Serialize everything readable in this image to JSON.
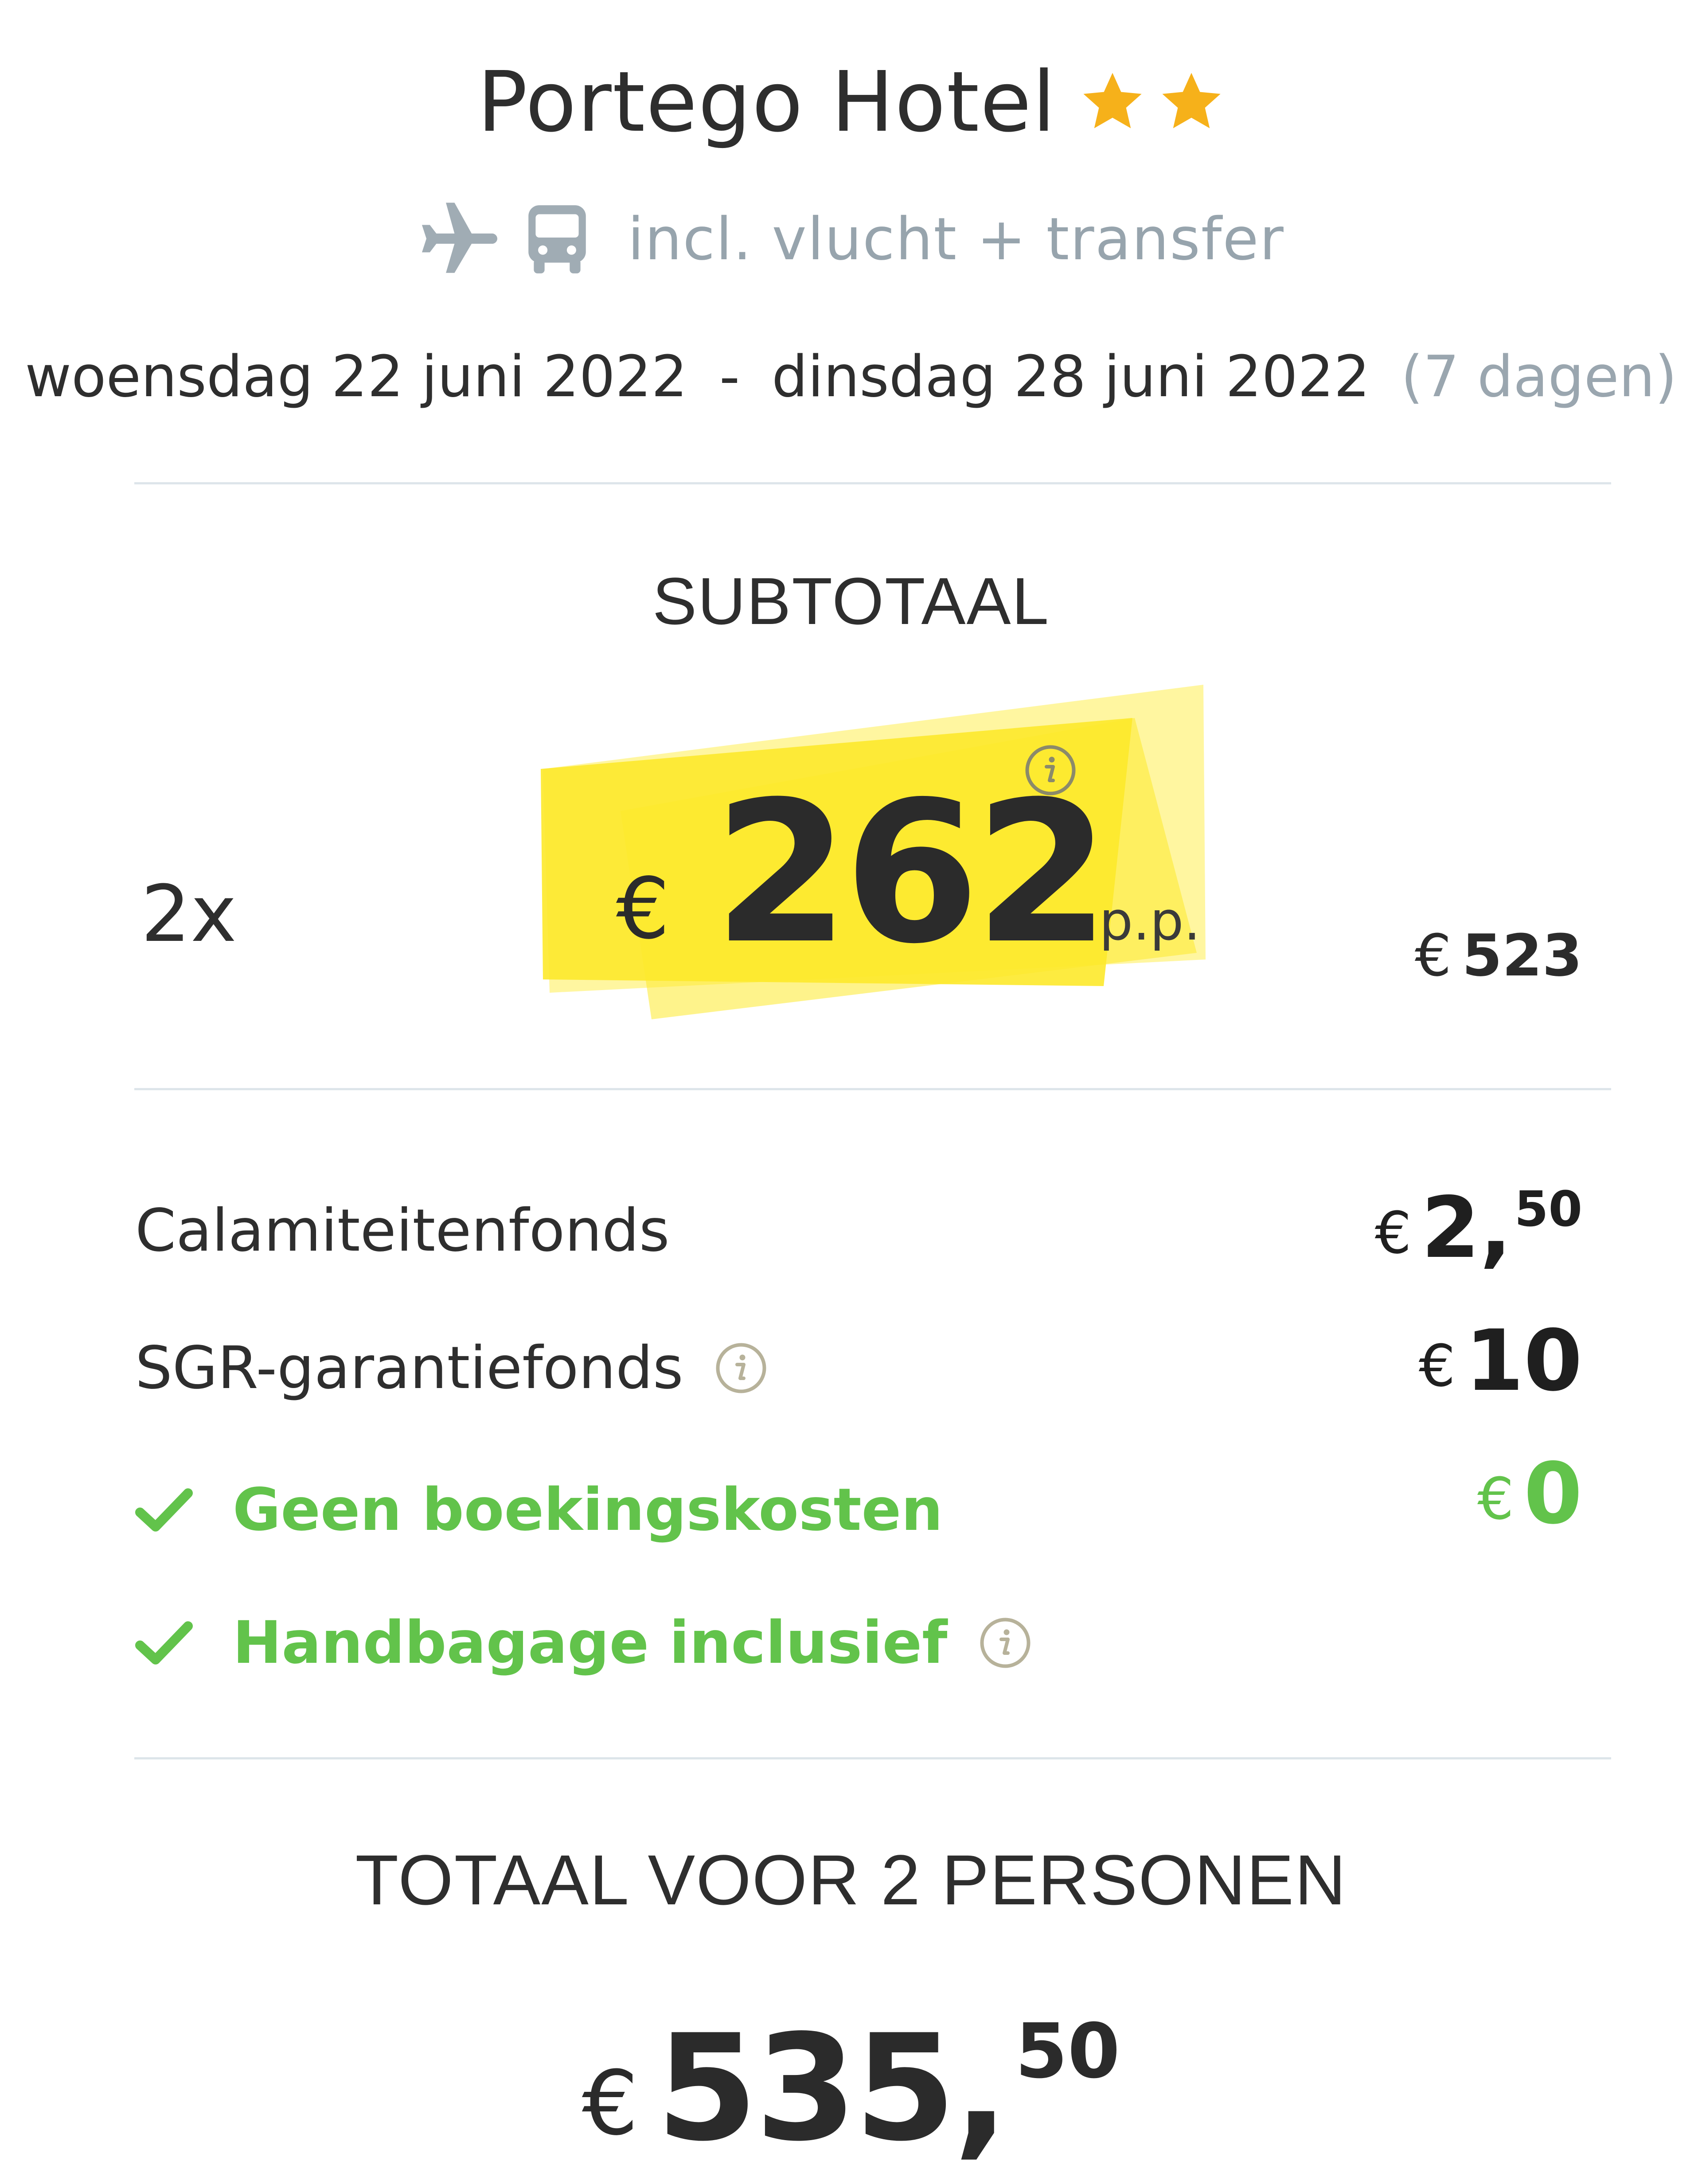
{
  "hotel": {
    "name": "Portego Hotel",
    "stars": 2,
    "included_text": "incl. vlucht + transfer",
    "icons": [
      "airplane-icon",
      "bus-icon"
    ]
  },
  "dates": {
    "start": "woensdag 22 juni 2022",
    "separator": "-",
    "end": "dinsdag 28 juni 2022",
    "duration": "(7 dagen)"
  },
  "subtotal": {
    "title": "SUBTOTAAL",
    "quantity": "2x",
    "currency": "€",
    "price_per_person": "262",
    "per_person_label": "p.p.",
    "line_currency": "€",
    "line_total": "523"
  },
  "fees": [
    {
      "label": "Calamiteitenfonds",
      "currency": "€",
      "amount": "2,",
      "cents": "50"
    },
    {
      "label": "SGR-garantiefonds",
      "currency": "€",
      "amount": "10",
      "cents": ""
    },
    {
      "label": "Geen boekingskosten",
      "currency": "€",
      "amount": "0",
      "cents": ""
    },
    {
      "label": "Handbagage inclusief"
    }
  ],
  "total": {
    "title": "TOTAAL VOOR 2 PERSONEN",
    "currency": "€",
    "amount": "535,",
    "cents": "50"
  },
  "colors": {
    "accent_green": "#62c34b",
    "star": "#f6b11a",
    "highlight_yellow": "#fde92b",
    "muted": "#9aa6af"
  }
}
